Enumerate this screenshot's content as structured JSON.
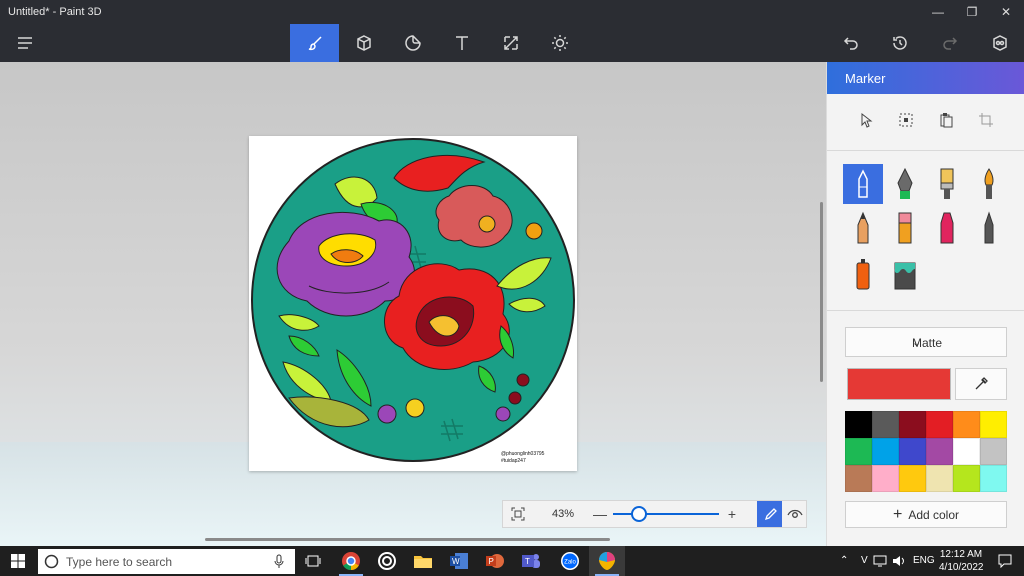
{
  "window": {
    "title": "Untitled* - Paint 3D",
    "controls": [
      "minimize-icon",
      "maximize-icon",
      "close-icon"
    ]
  },
  "toolbar": {
    "left": "menu-icon",
    "center": [
      "brushes-icon",
      "3d-shapes-icon",
      "stickers-icon",
      "text-icon",
      "canvas-icon",
      "effects-icon"
    ],
    "active": "brushes-icon",
    "right": [
      "undo-icon",
      "history-icon",
      "redo-icon",
      "mixed-reality-icon"
    ]
  },
  "canvas": {
    "watermark_line1": "@phuonglinh03795",
    "watermark_line2": "#tuidap247"
  },
  "zoom": {
    "percent": "43%",
    "level": 0.2,
    "minus": "—",
    "plus": "+"
  },
  "panel": {
    "title": "Marker",
    "select_tools": [
      "select-icon",
      "select-region-icon",
      "paste-icon",
      "crop-icon"
    ],
    "brushes": [
      {
        "name": "marker",
        "color": "#3a6ee0"
      },
      {
        "name": "calligraphy-pen",
        "color": "#5a5a5a"
      },
      {
        "name": "oil-brush",
        "color": "#f0b43c"
      },
      {
        "name": "watercolor",
        "color": "#f0a020"
      },
      {
        "name": "pixel-pen",
        "color": "#e0a060"
      },
      {
        "name": "pencil",
        "color": "#f08080"
      },
      {
        "name": "eraser",
        "color": "#e0245e"
      },
      {
        "name": "crayon",
        "color": "#4a4a4a"
      },
      {
        "name": "spray-can",
        "color": "#f06010"
      },
      {
        "name": "fill-bucket",
        "color": "#3aa0a0"
      }
    ],
    "finish": "Matte",
    "current_color": "#e53935",
    "palette": [
      "#000000",
      "#5a5a5a",
      "#8b0d1e",
      "#e31e24",
      "#ff8c1a",
      "#ffee00",
      "#1db954",
      "#00a2e8",
      "#3f48cc",
      "#a349a4",
      "#ffffff",
      "#c3c3c3",
      "#b97a57",
      "#ffaec9",
      "#ffc90e",
      "#efe4b0",
      "#b5e61d",
      "#7ff9f0"
    ],
    "add_color": "Add color"
  },
  "taskbar": {
    "search_placeholder": "Type here to search",
    "apps": [
      "task-view-icon",
      "chrome-icon",
      "cortana-ring-icon",
      "file-explorer-icon",
      "word-icon",
      "powerpoint-icon",
      "teams-icon",
      "zalo-icon",
      "paint3d-icon"
    ],
    "zalo_label": "Zalo",
    "language": "ENG",
    "time": "12:12 AM",
    "date": "4/10/2022"
  }
}
